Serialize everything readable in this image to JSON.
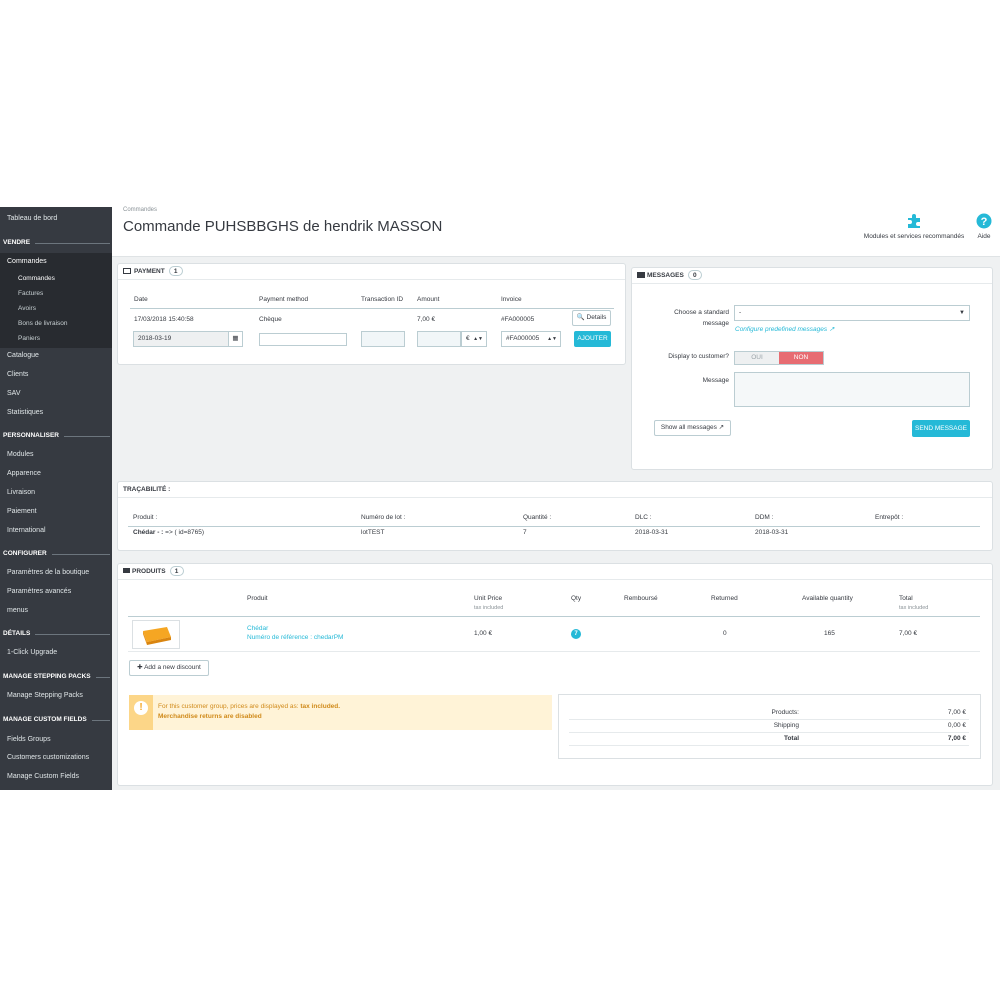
{
  "sidebar": {
    "dashboard": "Tableau de bord",
    "sections": {
      "vendre": "VENDRE",
      "personnaliser": "PERSONNALISER",
      "configurer": "CONFIGURER",
      "details": "DÉTAILS",
      "stepping": "MANAGE STEPPING PACKS",
      "custom_fields": "MANAGE CUSTOM FIELDS"
    },
    "items": {
      "commandes": "Commandes",
      "sub_commandes": "Commandes",
      "factures": "Factures",
      "avoirs": "Avoirs",
      "bons": "Bons de livraison",
      "paniers": "Paniers",
      "catalogue": "Catalogue",
      "clients": "Clients",
      "sav": "SAV",
      "statistiques": "Statistiques",
      "modules": "Modules",
      "apparence": "Apparence",
      "livraison": "Livraison",
      "paiement": "Paiement",
      "international": "International",
      "param_boutique": "Paramètres de la boutique",
      "param_avances": "Paramètres avancés",
      "menus": "menus",
      "one_click": "1-Click Upgrade",
      "manage_stepping": "Manage Stepping Packs",
      "fields_groups": "Fields Groups",
      "customers_custom": "Customers customizations",
      "manage_custom": "Manage Custom Fields"
    }
  },
  "header": {
    "breadcrumb": "Commandes",
    "title": "Commande PUHSBBGHS de hendrik MASSON",
    "modules_label": "Modules et services recommandés",
    "help_label": "Aide"
  },
  "payment": {
    "title": "PAYMENT",
    "count": "1",
    "columns": [
      "Date",
      "Payment method",
      "Transaction ID",
      "Amount",
      "Invoice"
    ],
    "row": {
      "date": "17/03/2018 15:40:58",
      "method": "Chèque",
      "transaction": "",
      "amount": "7,00 €",
      "invoice": "#FA000005"
    },
    "details_label": "Details",
    "form": {
      "date": "2018-03-19",
      "currency": "€",
      "invoice": "#FA000005"
    },
    "add_label": "AJOUTER"
  },
  "messages": {
    "title": "MESSAGES",
    "count": "0",
    "choose_label_1": "Choose a standard",
    "choose_label_2": "message",
    "select_value": "-",
    "configure_link": "Configure predefined messages",
    "display_label": "Display to customer?",
    "oui": "OUI",
    "non": "NON",
    "message_label": "Message",
    "show_all": "Show all messages",
    "send": "SEND MESSAGE"
  },
  "tracabilite": {
    "title": "TRAÇABILITÉ :",
    "columns": [
      "Produit :",
      "Numéro de lot :",
      "Quantité :",
      "DLC :",
      "DDM :",
      "Entrepôt :"
    ],
    "row": {
      "produit_bold": "Chédar - :",
      "produit_rest": " => ( id=8765)",
      "lot": "lotTEST",
      "qty": "7",
      "dlc": "2018-03-31",
      "ddm": "2018-03-31",
      "entrepot": ""
    }
  },
  "produits": {
    "title": "PRODUITS",
    "count": "1",
    "columns": {
      "produit": "Produit",
      "unit_price": "Unit Price",
      "unit_price_sub": "tax included",
      "qty": "Qty",
      "rembourse": "Remboursé",
      "returned": "Returned",
      "available": "Available quantity",
      "total": "Total",
      "total_sub": "tax included"
    },
    "row": {
      "name": "Chédar",
      "ref": "Numéro de référence : chedarPM",
      "unit_price": "1,00 €",
      "qty": "7",
      "returned": "0",
      "available": "165",
      "total": "7,00 €"
    },
    "add_discount": "Add a new discount",
    "alert_line1_a": "For this customer group, prices are displayed as: ",
    "alert_line1_b": "tax included.",
    "alert_line2": "Merchandise returns are disabled",
    "summary": [
      {
        "label": "Products:",
        "value": "7,00 €"
      },
      {
        "label": "Shipping",
        "value": "0,00 €"
      },
      {
        "label": "Total",
        "value": "7,00 €"
      }
    ]
  },
  "colors": {
    "accent": "#25b9d7",
    "sidebar": "#363a41",
    "danger": "#e76c72",
    "warning": "#fff3d7"
  }
}
